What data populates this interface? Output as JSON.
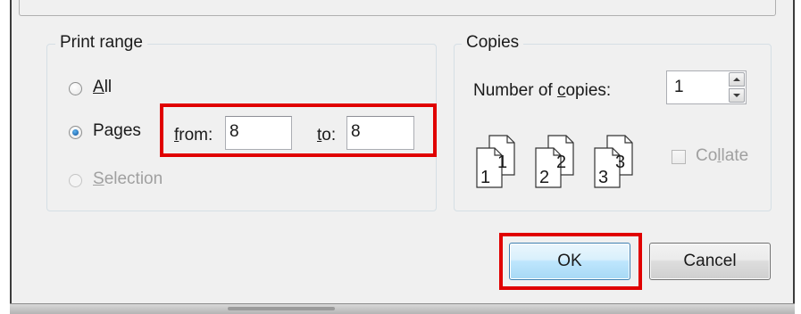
{
  "print_range": {
    "title": "Print range",
    "options": [
      {
        "label": "All",
        "selected": false,
        "disabled": false
      },
      {
        "label": "Pages",
        "selected": true,
        "disabled": false
      },
      {
        "label": "Selection",
        "selected": false,
        "disabled": true
      }
    ],
    "from_label": "from:",
    "from_value": "8",
    "to_label": "to:",
    "to_value": "8"
  },
  "copies": {
    "title": "Copies",
    "number_label": "Number of copies:",
    "number_value": "1",
    "collate_label": "Collate",
    "collate_checked": false,
    "collate_disabled": true,
    "collate_pages": [
      {
        "front": "1",
        "back": "1"
      },
      {
        "front": "2",
        "back": "2"
      },
      {
        "front": "3",
        "back": "3"
      }
    ]
  },
  "buttons": {
    "ok_label": "OK",
    "cancel_label": "Cancel"
  },
  "highlight_color": "#e00000"
}
